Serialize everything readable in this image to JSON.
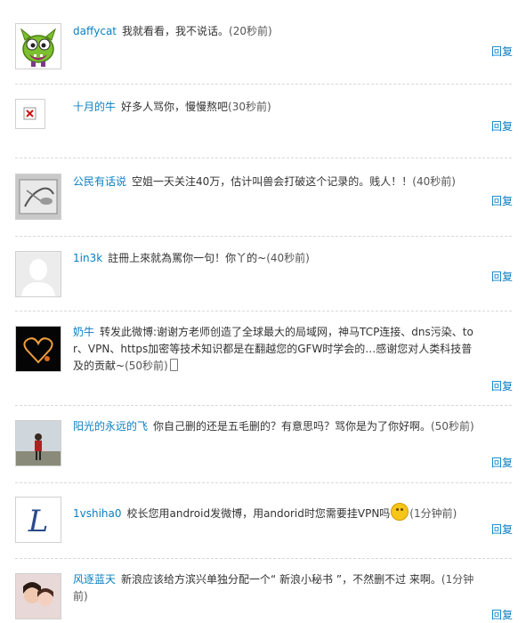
{
  "reply_label": "回复",
  "accent_color": "#0a7fc0",
  "comments": [
    {
      "user": "daffycat",
      "text": "我就看看，我不说话。",
      "time": "(20秒前)",
      "avatar_icon": "green-monster-avatar"
    },
    {
      "user": "十月的牛",
      "text": "好多人骂你，慢慢熬吧",
      "time": "(30秒前)",
      "avatar_icon": "broken-image-icon"
    },
    {
      "user": "公民有话说",
      "text": "空姐一天关注40万，估计叫兽会打破这个记录的。贱人！！",
      "time": "(40秒前)",
      "avatar_icon": "pencil-drawing-avatar"
    },
    {
      "user": "1in3k",
      "text": "註冊上來就為罵你一句！你丫的~",
      "time": "(40秒前)",
      "avatar_icon": "default-avatar"
    },
    {
      "user": "奶牛",
      "text": "转发此微博:谢谢方老师创造了全球最大的局域网，神马TCP连接、dns污染、tor、VPN、https加密等技术知识都是在翻越您的GFW时学会的…感谢您对人类科技普及的贡献~",
      "time": "(50秒前)",
      "avatar_icon": "light-heart-avatar"
    },
    {
      "user": "阳光的永远的飞",
      "text": "你自己删的还是五毛删的？有意思吗？骂你是为了你好啊。",
      "time": "(50秒前)",
      "avatar_icon": "person-photo-avatar"
    },
    {
      "user": "1vshiha0",
      "text": "校长您用android发微博，用andorid时您需要挂VPN吗",
      "time": "(1分钟前)",
      "avatar_icon": "letter-l-avatar"
    },
    {
      "user": "风逐蓝天",
      "text": "新浪应该给方滨兴单独分配一个“ 新浪小秘书 ”，不然删不过 来啊。",
      "time": "(1分钟前)",
      "avatar_icon": "couple-photo-avatar"
    }
  ]
}
